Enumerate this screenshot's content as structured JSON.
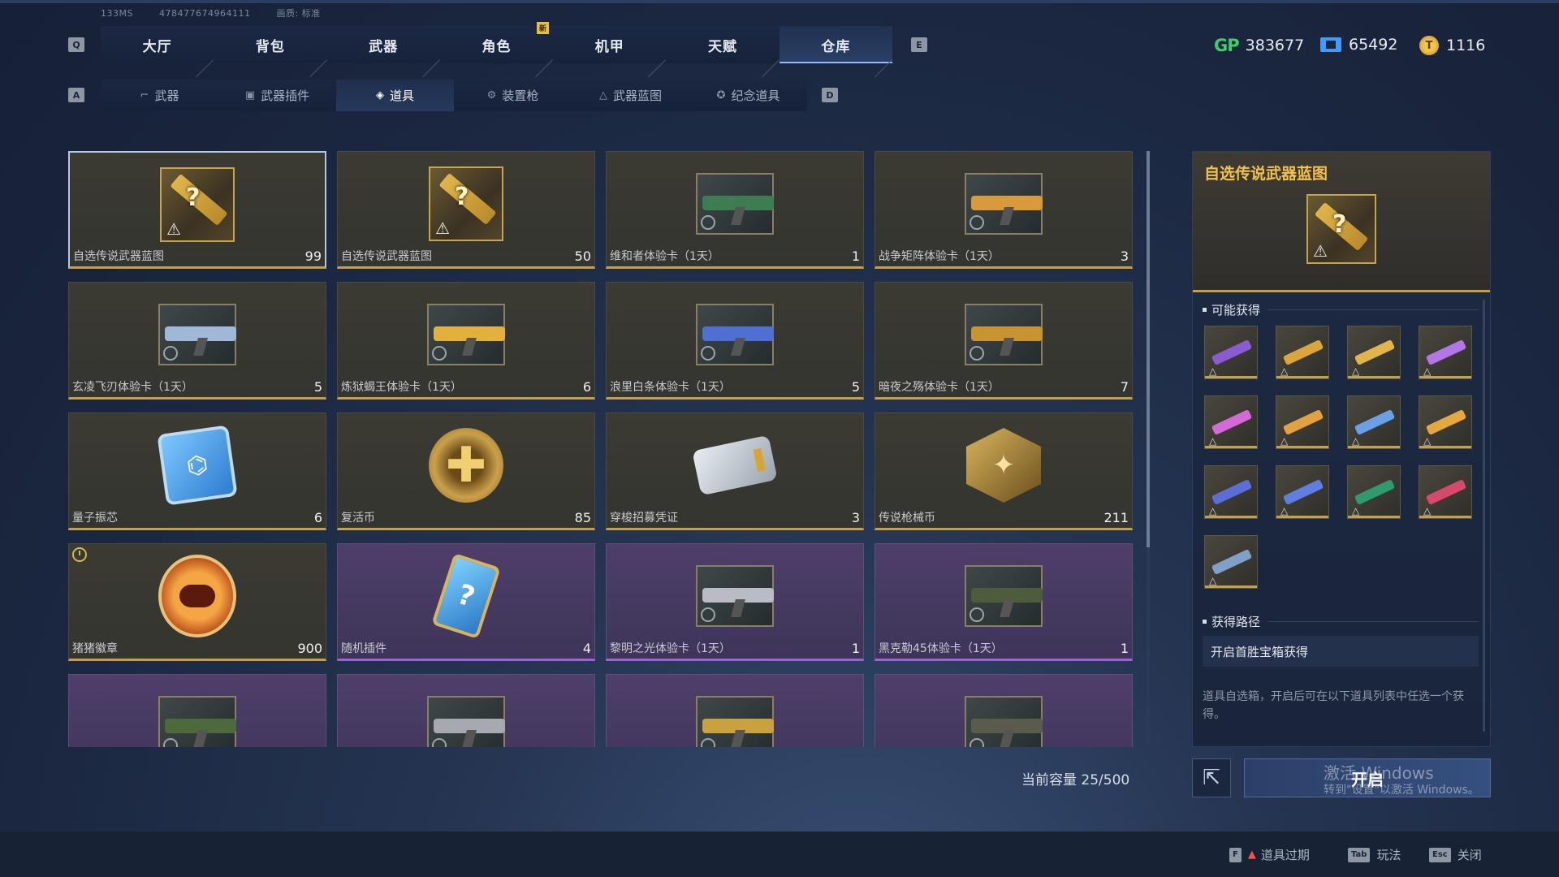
{
  "status": {
    "ping": "133MS",
    "uid": "478477674964111",
    "quality": "画质: 标准"
  },
  "keys": {
    "prev_main": "Q",
    "next_main": "E",
    "prev_sub": "A",
    "next_sub": "D"
  },
  "main_tabs": [
    {
      "label": "大厅",
      "active": false
    },
    {
      "label": "背包",
      "active": false
    },
    {
      "label": "武器",
      "active": false
    },
    {
      "label": "角色",
      "active": false,
      "badge": "新"
    },
    {
      "label": "机甲",
      "active": false
    },
    {
      "label": "天赋",
      "active": false
    },
    {
      "label": "仓库",
      "active": true
    }
  ],
  "currency": {
    "gp_icon": "GP",
    "gp": "383677",
    "tickets": "65492",
    "coins": "1116"
  },
  "sub_tabs": [
    {
      "label": "武器",
      "icon": "rifle-icon"
    },
    {
      "label": "武器插件",
      "icon": "chip-icon"
    },
    {
      "label": "道具",
      "icon": "item-icon",
      "active": true
    },
    {
      "label": "装置枪",
      "icon": "device-icon"
    },
    {
      "label": "武器蓝图",
      "icon": "blueprint-icon"
    },
    {
      "label": "纪念道具",
      "icon": "medal-icon"
    }
  ],
  "items": [
    {
      "name": "自选传说武器蓝图",
      "count": "99",
      "type": "blueprint",
      "rarity": "gold",
      "selected": true
    },
    {
      "name": "自选传说武器蓝图",
      "count": "50",
      "type": "blueprint",
      "rarity": "gold"
    },
    {
      "name": "维和者体验卡（1天）",
      "count": "1",
      "type": "trial",
      "rarity": "gold",
      "color": "#3e7c52"
    },
    {
      "name": "战争矩阵体验卡（1天）",
      "count": "3",
      "type": "trial",
      "rarity": "gold",
      "color": "#d89a3a"
    },
    {
      "name": "玄凌飞刃体验卡（1天）",
      "count": "5",
      "type": "trial",
      "rarity": "gold",
      "color": "#9fb8d8"
    },
    {
      "name": "炼狱蝎王体验卡（1天）",
      "count": "6",
      "type": "trial",
      "rarity": "gold",
      "color": "#e2b13d"
    },
    {
      "name": "浪里白条体验卡（1天）",
      "count": "5",
      "type": "trial",
      "rarity": "gold",
      "color": "#4f6fd2"
    },
    {
      "name": "暗夜之殇体验卡（1天）",
      "count": "7",
      "type": "trial",
      "rarity": "gold",
      "color": "#c89432"
    },
    {
      "name": "量子振芯",
      "count": "6",
      "type": "chip",
      "rarity": "gold"
    },
    {
      "name": "复活币",
      "count": "85",
      "type": "coin",
      "rarity": "gold"
    },
    {
      "name": "穿梭招募凭证",
      "count": "3",
      "type": "ticket",
      "rarity": "gold"
    },
    {
      "name": "传说枪械币",
      "count": "211",
      "type": "hex",
      "rarity": "gold"
    },
    {
      "name": "猪猪徽章",
      "count": "900",
      "type": "pig",
      "rarity": "gold",
      "timed": true
    },
    {
      "name": "随机插件",
      "count": "4",
      "type": "plug",
      "rarity": "purple"
    },
    {
      "name": "黎明之光体验卡（1天）",
      "count": "1",
      "type": "trial",
      "rarity": "purple",
      "color": "#b9bcc4"
    },
    {
      "name": "黑克勒45体验卡（1天）",
      "count": "1",
      "type": "trial",
      "rarity": "purple",
      "color": "#4d5c3c"
    },
    {
      "name": "",
      "count": "",
      "type": "trial",
      "rarity": "purple",
      "color": "#4e6a3c"
    },
    {
      "name": "",
      "count": "",
      "type": "trial",
      "rarity": "purple",
      "color": "#a7a9b0"
    },
    {
      "name": "",
      "count": "",
      "type": "trial",
      "rarity": "purple",
      "color": "#c9a23f"
    },
    {
      "name": "",
      "count": "",
      "type": "trial",
      "rarity": "purple",
      "color": "#5b5b4b"
    }
  ],
  "capacity": "当前容量 25/500",
  "detail": {
    "title": "自选传说武器蓝图",
    "possible_label": "可能获得",
    "rewards": [
      "#8b5bd4",
      "#d9a63b",
      "#e0b54a",
      "#b276e6",
      "#d36ad8",
      "#e2a23d",
      "#6aa0e8",
      "#e4a83e",
      "#5b6ed8",
      "#5e7fe0",
      "#2f9a6c",
      "#d8486a",
      "#7fa0c8"
    ],
    "route_label": "获得路径",
    "route": "开启首胜宝箱获得",
    "description": "道具自选箱，开启后可在以下道具列表中任选一个获得。",
    "open_button": "开启"
  },
  "watermark": {
    "line1": "激活 Windows",
    "line2": "转到\"设置\"以激活 Windows。"
  },
  "hints": [
    {
      "key": "F",
      "label": "道具过期",
      "warn": true
    },
    {
      "key": "Tab",
      "label": "玩法"
    },
    {
      "key": "Esc",
      "label": "关闭"
    }
  ]
}
